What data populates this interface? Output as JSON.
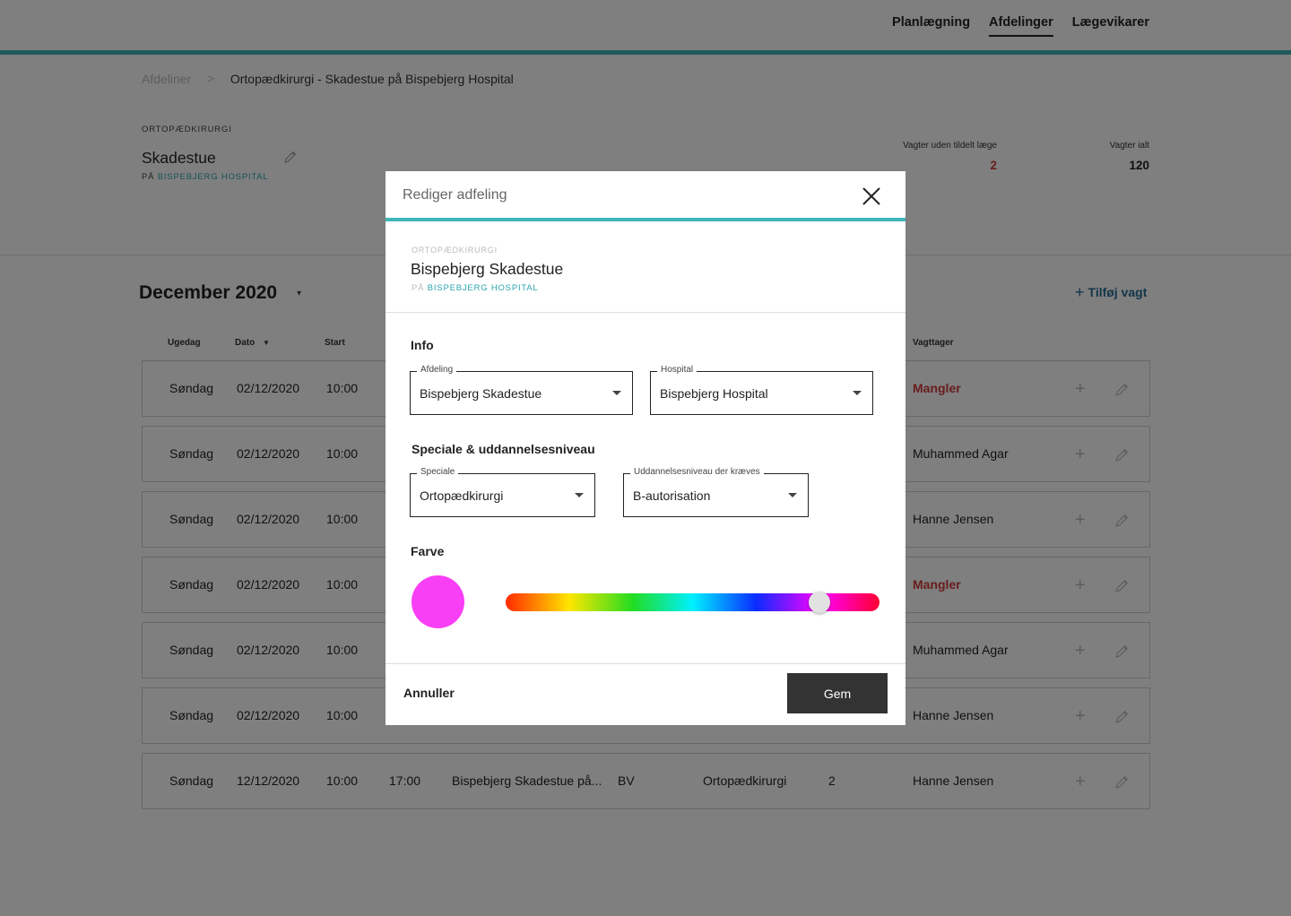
{
  "nav": {
    "items": [
      {
        "label": "Planlægning",
        "active": false
      },
      {
        "label": "Afdelinger",
        "active": true
      },
      {
        "label": "Lægevikarer",
        "active": false
      }
    ]
  },
  "breadcrumb": {
    "root": "Afdeliner",
    "separator": ">",
    "current": "Ortopædkirurgi - Skadestue på Bispebjerg Hospital"
  },
  "department": {
    "category": "ORTOPÆDKIRURGI",
    "name": "Skadestue",
    "sub_prefix": "PÅ",
    "hospital": "BISPEBJERG HOSPITAL"
  },
  "stats": {
    "unassigned_label": "Vagter uden tildelt læge",
    "unassigned_value": "2",
    "total_label": "Vagter ialt",
    "total_value": "120"
  },
  "schedule": {
    "month": "December 2020",
    "add_label": "Tilføj vagt",
    "columns": {
      "weekday": "Ugedag",
      "date": "Dato",
      "start": "Start",
      "taker": "Vagttager"
    },
    "rows": [
      {
        "weekday": "Søndag",
        "date": "02/12/2020",
        "start": "10:00",
        "end": "",
        "department": "",
        "type": "",
        "specialty": "",
        "count": "",
        "taker": "Mangler",
        "missing": true
      },
      {
        "weekday": "Søndag",
        "date": "02/12/2020",
        "start": "10:00",
        "end": "",
        "department": "",
        "type": "",
        "specialty": "",
        "count": "",
        "taker": "Muhammed Agar",
        "missing": false
      },
      {
        "weekday": "Søndag",
        "date": "02/12/2020",
        "start": "10:00",
        "end": "",
        "department": "",
        "type": "",
        "specialty": "",
        "count": "",
        "taker": "Hanne Jensen",
        "missing": false
      },
      {
        "weekday": "Søndag",
        "date": "02/12/2020",
        "start": "10:00",
        "end": "",
        "department": "",
        "type": "",
        "specialty": "",
        "count": "",
        "taker": "Mangler",
        "missing": true
      },
      {
        "weekday": "Søndag",
        "date": "02/12/2020",
        "start": "10:00",
        "end": "",
        "department": "",
        "type": "",
        "specialty": "",
        "count": "",
        "taker": "Muhammed Agar",
        "missing": false
      },
      {
        "weekday": "Søndag",
        "date": "02/12/2020",
        "start": "10:00",
        "end": "",
        "department": "",
        "type": "",
        "specialty": "",
        "count": "",
        "taker": "Hanne Jensen",
        "missing": false
      },
      {
        "weekday": "Søndag",
        "date": "12/12/2020",
        "start": "10:00",
        "end": "17:00",
        "department": "Bispebjerg Skadestue på...",
        "type": "BV",
        "specialty": "Ortopædkirurgi",
        "count": "2",
        "taker": "Hanne Jensen",
        "missing": false
      }
    ]
  },
  "modal": {
    "title": "Rediger adfeling",
    "category": "ORTOPÆDKIRURGI",
    "name": "Bispebjerg Skadestue",
    "sub_prefix": "PÅ",
    "hospital": "BISPEBJERG HOSPITAL",
    "info_heading": "Info",
    "afdeling": {
      "label": "Afdeling",
      "value": "Bispebjerg Skadestue"
    },
    "hospital_field": {
      "label": "Hospital",
      "value": "Bispebjerg Hospital"
    },
    "specialty_heading": "Speciale & uddannelsesniveau",
    "speciale": {
      "label": "Speciale",
      "value": "Ortopædkirurgi"
    },
    "level": {
      "label": "Uddannelsesniveau der kræves",
      "value": "B-autorisation"
    },
    "color_heading": "Farve",
    "color_value": "#f93ff5",
    "hue_position": 0.84,
    "cancel_label": "Annuller",
    "save_label": "Gem"
  },
  "colors": {
    "accent": "#3fb5b8",
    "link": "#2a6d96",
    "danger": "#d03a3a",
    "primary_button": "#333333"
  }
}
